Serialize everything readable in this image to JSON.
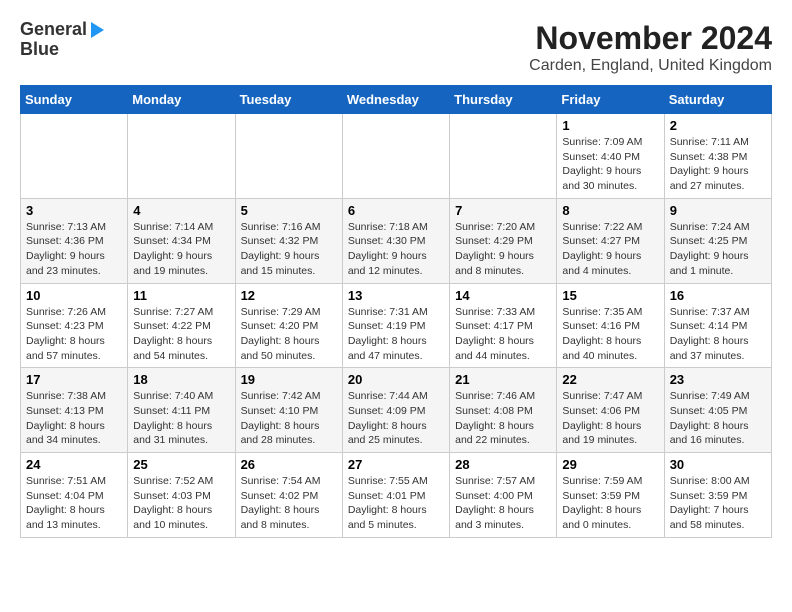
{
  "header": {
    "logo_general": "General",
    "logo_blue": "Blue",
    "title": "November 2024",
    "subtitle": "Carden, England, United Kingdom"
  },
  "weekdays": [
    "Sunday",
    "Monday",
    "Tuesday",
    "Wednesday",
    "Thursday",
    "Friday",
    "Saturday"
  ],
  "weeks": [
    [
      {
        "day": "",
        "info": ""
      },
      {
        "day": "",
        "info": ""
      },
      {
        "day": "",
        "info": ""
      },
      {
        "day": "",
        "info": ""
      },
      {
        "day": "",
        "info": ""
      },
      {
        "day": "1",
        "info": "Sunrise: 7:09 AM\nSunset: 4:40 PM\nDaylight: 9 hours\nand 30 minutes."
      },
      {
        "day": "2",
        "info": "Sunrise: 7:11 AM\nSunset: 4:38 PM\nDaylight: 9 hours\nand 27 minutes."
      }
    ],
    [
      {
        "day": "3",
        "info": "Sunrise: 7:13 AM\nSunset: 4:36 PM\nDaylight: 9 hours\nand 23 minutes."
      },
      {
        "day": "4",
        "info": "Sunrise: 7:14 AM\nSunset: 4:34 PM\nDaylight: 9 hours\nand 19 minutes."
      },
      {
        "day": "5",
        "info": "Sunrise: 7:16 AM\nSunset: 4:32 PM\nDaylight: 9 hours\nand 15 minutes."
      },
      {
        "day": "6",
        "info": "Sunrise: 7:18 AM\nSunset: 4:30 PM\nDaylight: 9 hours\nand 12 minutes."
      },
      {
        "day": "7",
        "info": "Sunrise: 7:20 AM\nSunset: 4:29 PM\nDaylight: 9 hours\nand 8 minutes."
      },
      {
        "day": "8",
        "info": "Sunrise: 7:22 AM\nSunset: 4:27 PM\nDaylight: 9 hours\nand 4 minutes."
      },
      {
        "day": "9",
        "info": "Sunrise: 7:24 AM\nSunset: 4:25 PM\nDaylight: 9 hours\nand 1 minute."
      }
    ],
    [
      {
        "day": "10",
        "info": "Sunrise: 7:26 AM\nSunset: 4:23 PM\nDaylight: 8 hours\nand 57 minutes."
      },
      {
        "day": "11",
        "info": "Sunrise: 7:27 AM\nSunset: 4:22 PM\nDaylight: 8 hours\nand 54 minutes."
      },
      {
        "day": "12",
        "info": "Sunrise: 7:29 AM\nSunset: 4:20 PM\nDaylight: 8 hours\nand 50 minutes."
      },
      {
        "day": "13",
        "info": "Sunrise: 7:31 AM\nSunset: 4:19 PM\nDaylight: 8 hours\nand 47 minutes."
      },
      {
        "day": "14",
        "info": "Sunrise: 7:33 AM\nSunset: 4:17 PM\nDaylight: 8 hours\nand 44 minutes."
      },
      {
        "day": "15",
        "info": "Sunrise: 7:35 AM\nSunset: 4:16 PM\nDaylight: 8 hours\nand 40 minutes."
      },
      {
        "day": "16",
        "info": "Sunrise: 7:37 AM\nSunset: 4:14 PM\nDaylight: 8 hours\nand 37 minutes."
      }
    ],
    [
      {
        "day": "17",
        "info": "Sunrise: 7:38 AM\nSunset: 4:13 PM\nDaylight: 8 hours\nand 34 minutes."
      },
      {
        "day": "18",
        "info": "Sunrise: 7:40 AM\nSunset: 4:11 PM\nDaylight: 8 hours\nand 31 minutes."
      },
      {
        "day": "19",
        "info": "Sunrise: 7:42 AM\nSunset: 4:10 PM\nDaylight: 8 hours\nand 28 minutes."
      },
      {
        "day": "20",
        "info": "Sunrise: 7:44 AM\nSunset: 4:09 PM\nDaylight: 8 hours\nand 25 minutes."
      },
      {
        "day": "21",
        "info": "Sunrise: 7:46 AM\nSunset: 4:08 PM\nDaylight: 8 hours\nand 22 minutes."
      },
      {
        "day": "22",
        "info": "Sunrise: 7:47 AM\nSunset: 4:06 PM\nDaylight: 8 hours\nand 19 minutes."
      },
      {
        "day": "23",
        "info": "Sunrise: 7:49 AM\nSunset: 4:05 PM\nDaylight: 8 hours\nand 16 minutes."
      }
    ],
    [
      {
        "day": "24",
        "info": "Sunrise: 7:51 AM\nSunset: 4:04 PM\nDaylight: 8 hours\nand 13 minutes."
      },
      {
        "day": "25",
        "info": "Sunrise: 7:52 AM\nSunset: 4:03 PM\nDaylight: 8 hours\nand 10 minutes."
      },
      {
        "day": "26",
        "info": "Sunrise: 7:54 AM\nSunset: 4:02 PM\nDaylight: 8 hours\nand 8 minutes."
      },
      {
        "day": "27",
        "info": "Sunrise: 7:55 AM\nSunset: 4:01 PM\nDaylight: 8 hours\nand 5 minutes."
      },
      {
        "day": "28",
        "info": "Sunrise: 7:57 AM\nSunset: 4:00 PM\nDaylight: 8 hours\nand 3 minutes."
      },
      {
        "day": "29",
        "info": "Sunrise: 7:59 AM\nSunset: 3:59 PM\nDaylight: 8 hours\nand 0 minutes."
      },
      {
        "day": "30",
        "info": "Sunrise: 8:00 AM\nSunset: 3:59 PM\nDaylight: 7 hours\nand 58 minutes."
      }
    ]
  ]
}
